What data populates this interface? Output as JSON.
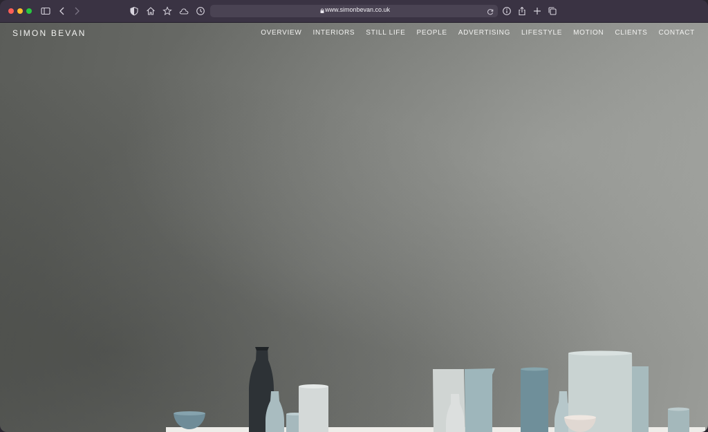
{
  "browser": {
    "url": "www.simonbevan.co.uk",
    "icons": [
      "sidebar-icon",
      "back-icon",
      "forward-icon",
      "privacy-shield-icon",
      "home-icon",
      "bookmark-star-icon",
      "icloud-icon",
      "history-icon",
      "reload-icon",
      "info-icon",
      "share-icon",
      "new-tab-icon",
      "tab-overview-icon"
    ],
    "colors": {
      "toolbar": "#3a3343",
      "address_bar": "#4a4353"
    }
  },
  "site": {
    "brand": "SIMON BEVAN",
    "nav": [
      "OVERVIEW",
      "INTERIORS",
      "STILL LIFE",
      "PEOPLE",
      "ADVERTISING",
      "LIFESTYLE",
      "MOTION",
      "CLIENTS",
      "CONTACT"
    ]
  }
}
